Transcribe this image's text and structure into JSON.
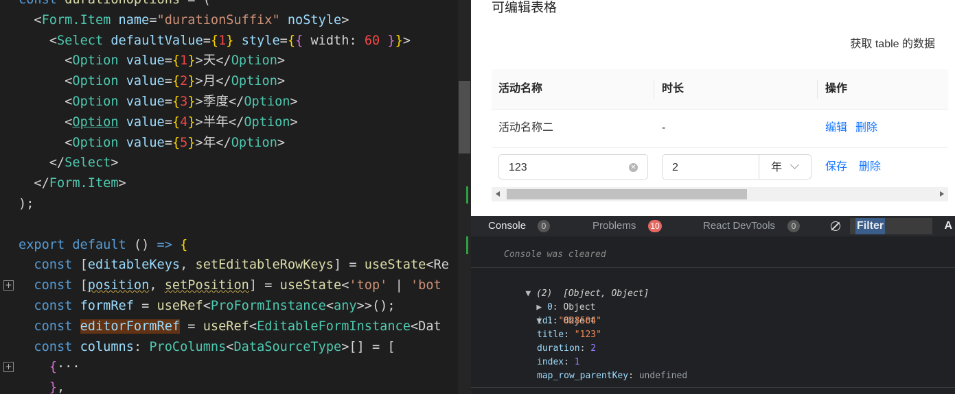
{
  "editor": {
    "lines": [
      {
        "indent": "",
        "parts": [
          [
            "kw",
            "const "
          ],
          [
            "fn",
            "durationOptions"
          ],
          [
            "punc",
            " = ("
          ]
        ]
      },
      {
        "indent": "  ",
        "parts": [
          [
            "punc",
            "<"
          ],
          [
            "comp",
            "Form.Item"
          ],
          [
            "attr",
            " name"
          ],
          [
            "punc",
            "="
          ],
          [
            "str",
            "\"durationSuffix\""
          ],
          [
            "attr",
            " noStyle"
          ],
          [
            "punc",
            ">"
          ]
        ]
      },
      {
        "indent": "    ",
        "parts": [
          [
            "punc",
            "<"
          ],
          [
            "comp",
            "Select"
          ],
          [
            "attr",
            " defaultValue"
          ],
          [
            "punc",
            "="
          ],
          [
            "br2",
            "{"
          ],
          [
            "num",
            "1"
          ],
          [
            "br2",
            "}"
          ],
          [
            "attr",
            " style"
          ],
          [
            "punc",
            "="
          ],
          [
            "br2",
            "{"
          ],
          [
            "br",
            "{"
          ],
          [
            "punc",
            " width: "
          ],
          [
            "num",
            "60"
          ],
          [
            "br",
            " }"
          ],
          [
            "br2",
            "}"
          ],
          [
            "punc",
            ">"
          ]
        ]
      },
      {
        "indent": "      ",
        "parts": [
          [
            "punc",
            "<"
          ],
          [
            "comp",
            "Option"
          ],
          [
            "attr",
            " value"
          ],
          [
            "punc",
            "="
          ],
          [
            "br2",
            "{"
          ],
          [
            "num",
            "1"
          ],
          [
            "br2",
            "}"
          ],
          [
            "punc",
            ">天</"
          ],
          [
            "comp",
            "Option"
          ],
          [
            "punc",
            ">"
          ]
        ]
      },
      {
        "indent": "      ",
        "parts": [
          [
            "punc",
            "<"
          ],
          [
            "comp",
            "Option"
          ],
          [
            "attr",
            " value"
          ],
          [
            "punc",
            "="
          ],
          [
            "br2",
            "{"
          ],
          [
            "num",
            "2"
          ],
          [
            "br2",
            "}"
          ],
          [
            "punc",
            ">月</"
          ],
          [
            "comp",
            "Option"
          ],
          [
            "punc",
            ">"
          ]
        ]
      },
      {
        "indent": "      ",
        "parts": [
          [
            "punc",
            "<"
          ],
          [
            "comp",
            "Option"
          ],
          [
            "attr",
            " value"
          ],
          [
            "punc",
            "="
          ],
          [
            "br2",
            "{"
          ],
          [
            "num",
            "3"
          ],
          [
            "br2",
            "}"
          ],
          [
            "punc",
            ">季度</"
          ],
          [
            "comp",
            "Option"
          ],
          [
            "punc",
            ">"
          ]
        ]
      },
      {
        "indent": "      ",
        "parts": [
          [
            "punc",
            "<"
          ],
          [
            "comp ul",
            "Option"
          ],
          [
            "attr",
            " value"
          ],
          [
            "punc",
            "="
          ],
          [
            "br2",
            "{"
          ],
          [
            "num",
            "4"
          ],
          [
            "br2",
            "}"
          ],
          [
            "punc",
            ">半年</"
          ],
          [
            "comp",
            "Option"
          ],
          [
            "punc",
            ">"
          ]
        ]
      },
      {
        "indent": "      ",
        "parts": [
          [
            "punc",
            "<"
          ],
          [
            "comp",
            "Option"
          ],
          [
            "attr",
            " value"
          ],
          [
            "punc",
            "="
          ],
          [
            "br2",
            "{"
          ],
          [
            "num",
            "5"
          ],
          [
            "br2",
            "}"
          ],
          [
            "punc",
            ">年</"
          ],
          [
            "comp",
            "Option"
          ],
          [
            "punc",
            ">"
          ]
        ]
      },
      {
        "indent": "    ",
        "parts": [
          [
            "punc",
            "</"
          ],
          [
            "comp",
            "Select"
          ],
          [
            "punc",
            ">"
          ]
        ]
      },
      {
        "indent": "  ",
        "parts": [
          [
            "punc",
            "</"
          ],
          [
            "comp",
            "Form.Item"
          ],
          [
            "punc",
            ">"
          ]
        ]
      },
      {
        "indent": "",
        "parts": [
          [
            "punc",
            ");"
          ]
        ]
      },
      {
        "indent": "",
        "parts": []
      },
      {
        "indent": "",
        "parts": [
          [
            "kw",
            "export default "
          ],
          [
            "punc",
            "() "
          ],
          [
            "kw",
            "=>"
          ],
          [
            "br2",
            " {"
          ]
        ]
      },
      {
        "indent": "  ",
        "parts": [
          [
            "kw",
            "const "
          ],
          [
            "punc",
            "["
          ],
          [
            "var",
            "editableKeys"
          ],
          [
            "punc",
            ", "
          ],
          [
            "fn",
            "setEditableRowKeys"
          ],
          [
            "punc",
            "] = "
          ],
          [
            "fn",
            "useState"
          ],
          [
            "punc",
            "<Re"
          ]
        ]
      },
      {
        "indent": "  ",
        "parts": [
          [
            "kw",
            "const "
          ],
          [
            "punc",
            "["
          ],
          [
            "var sq",
            "position"
          ],
          [
            "punc",
            ", "
          ],
          [
            "fn sq",
            "setPosition"
          ],
          [
            "punc",
            "] = "
          ],
          [
            "fn",
            "useState"
          ],
          [
            "punc",
            "<"
          ],
          [
            "str",
            "'top'"
          ],
          [
            "punc",
            " | "
          ],
          [
            "str",
            "'bot"
          ]
        ]
      },
      {
        "indent": "  ",
        "parts": [
          [
            "kw",
            "const "
          ],
          [
            "var",
            "formRef"
          ],
          [
            "punc",
            " = "
          ],
          [
            "fn",
            "useRef"
          ],
          [
            "punc",
            "<"
          ],
          [
            "type",
            "ProFormInstance"
          ],
          [
            "punc",
            "<"
          ],
          [
            "type",
            "any"
          ],
          [
            "punc",
            ">>();"
          ]
        ]
      },
      {
        "indent": "  ",
        "parts": [
          [
            "kw",
            "const "
          ],
          [
            "var hl",
            "editorFormRef"
          ],
          [
            "punc",
            " = "
          ],
          [
            "fn",
            "useRef"
          ],
          [
            "punc",
            "<"
          ],
          [
            "type",
            "EditableFormInstance"
          ],
          [
            "punc",
            "<Dat"
          ]
        ]
      },
      {
        "indent": "  ",
        "parts": [
          [
            "kw",
            "const "
          ],
          [
            "var",
            "columns"
          ],
          [
            "punc",
            ": "
          ],
          [
            "type",
            "ProColumns"
          ],
          [
            "punc",
            "<"
          ],
          [
            "type",
            "DataSourceType"
          ],
          [
            "punc",
            ">[] = ["
          ]
        ]
      },
      {
        "indent": "    ",
        "parts": [
          [
            "br",
            "{"
          ],
          [
            "punc",
            "···"
          ]
        ]
      },
      {
        "indent": "    ",
        "parts": [
          [
            "br",
            "}"
          ],
          [
            "punc",
            ","
          ]
        ]
      }
    ]
  },
  "preview": {
    "title": "可编辑表格",
    "get_data_button": "获取 table 的数据",
    "columns": [
      "活动名称",
      "时长",
      "操作"
    ],
    "row1": {
      "name": "活动名称二",
      "duration": "-",
      "actions": [
        "编辑",
        "删除"
      ]
    },
    "row2": {
      "name_value": "123",
      "duration_value": "2",
      "duration_suffix": "年",
      "actions": [
        "保存",
        "删除"
      ]
    }
  },
  "devtools": {
    "tabs": [
      {
        "label": "Console",
        "count": "0"
      },
      {
        "label": "Problems",
        "count": "10"
      },
      {
        "label": "React DevTools",
        "count": "0"
      }
    ],
    "filter_label": "Filter",
    "more_label": "A",
    "console": {
      "cleared_msg": "Console was cleared",
      "array_summary": "(2)",
      "array_preview": "[Object, Object]",
      "item0": {
        "key": "0",
        "type": "Object"
      },
      "item1": {
        "key": "1",
        "type": "Object"
      },
      "fields": [
        {
          "key": "id",
          "value": "\"828504\"",
          "kind": "string"
        },
        {
          "key": "title",
          "value": "\"123\"",
          "kind": "string"
        },
        {
          "key": "duration",
          "value": "2",
          "kind": "number"
        },
        {
          "key": "index",
          "value": "1",
          "kind": "number"
        },
        {
          "key": "map_row_parentKey",
          "value": "undefined",
          "kind": "undefined"
        }
      ]
    }
  }
}
